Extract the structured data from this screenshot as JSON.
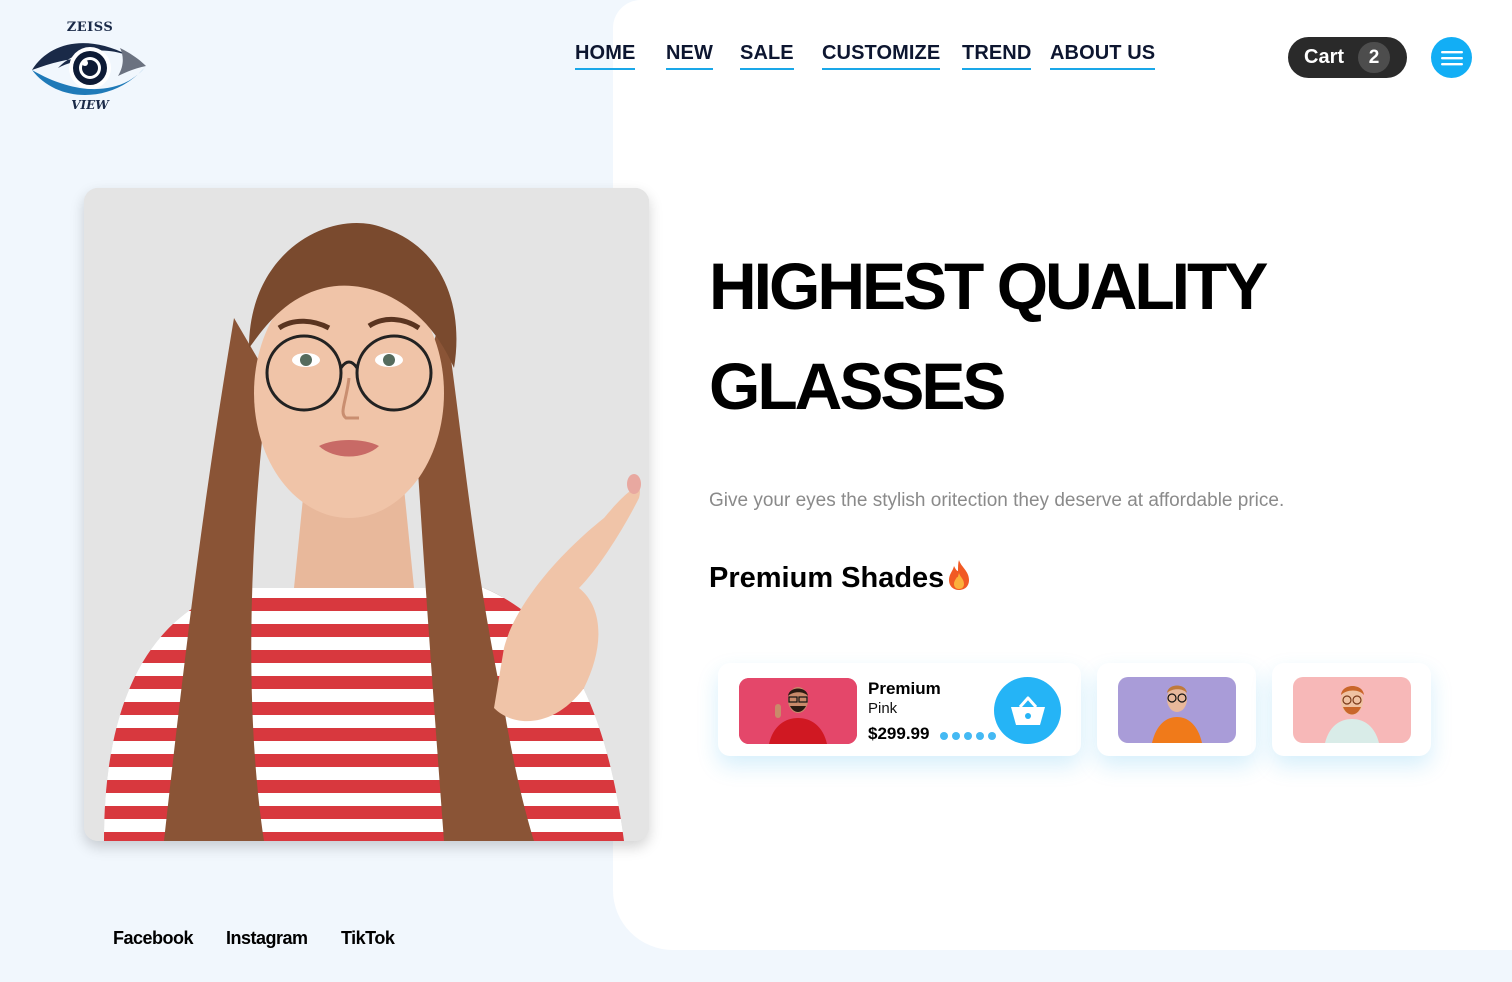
{
  "brand": {
    "name_top": "ZEISS",
    "name_bottom": "VIEW",
    "logo_icon": "eye-icon"
  },
  "nav": {
    "items": [
      {
        "label": "HOME"
      },
      {
        "label": "NEW"
      },
      {
        "label": "SALE"
      },
      {
        "label": "CUSTOMIZE"
      },
      {
        "label": "TREND"
      },
      {
        "label": "ABOUT US"
      }
    ]
  },
  "cart": {
    "label": "Cart",
    "count": "2"
  },
  "menu": {
    "icon": "hamburger-icon"
  },
  "hero": {
    "headline": "HIGHEST QUALITY GLASSES",
    "subtitle": "Give your eyes the stylish oritection they deserve at affordable price.",
    "section_title": "Premium Shades",
    "section_icon": "fire-icon"
  },
  "products": [
    {
      "name": "Premium",
      "color": "Pink",
      "price": "$299.99",
      "rating_dots": 5,
      "action_icon": "basket-icon"
    },
    {
      "thumb_bg": "#a89bd9"
    },
    {
      "thumb_bg": "#f7b9b9"
    }
  ],
  "social": [
    {
      "label": "Facebook"
    },
    {
      "label": "Instagram"
    },
    {
      "label": "TikTok"
    }
  ],
  "colors": {
    "accent": "#12aef5",
    "nav_underline": "#1aa7e8",
    "page_bg": "#f1f7fd",
    "panel_bg": "#ffffff",
    "cart_bg": "#2a2a2a"
  }
}
